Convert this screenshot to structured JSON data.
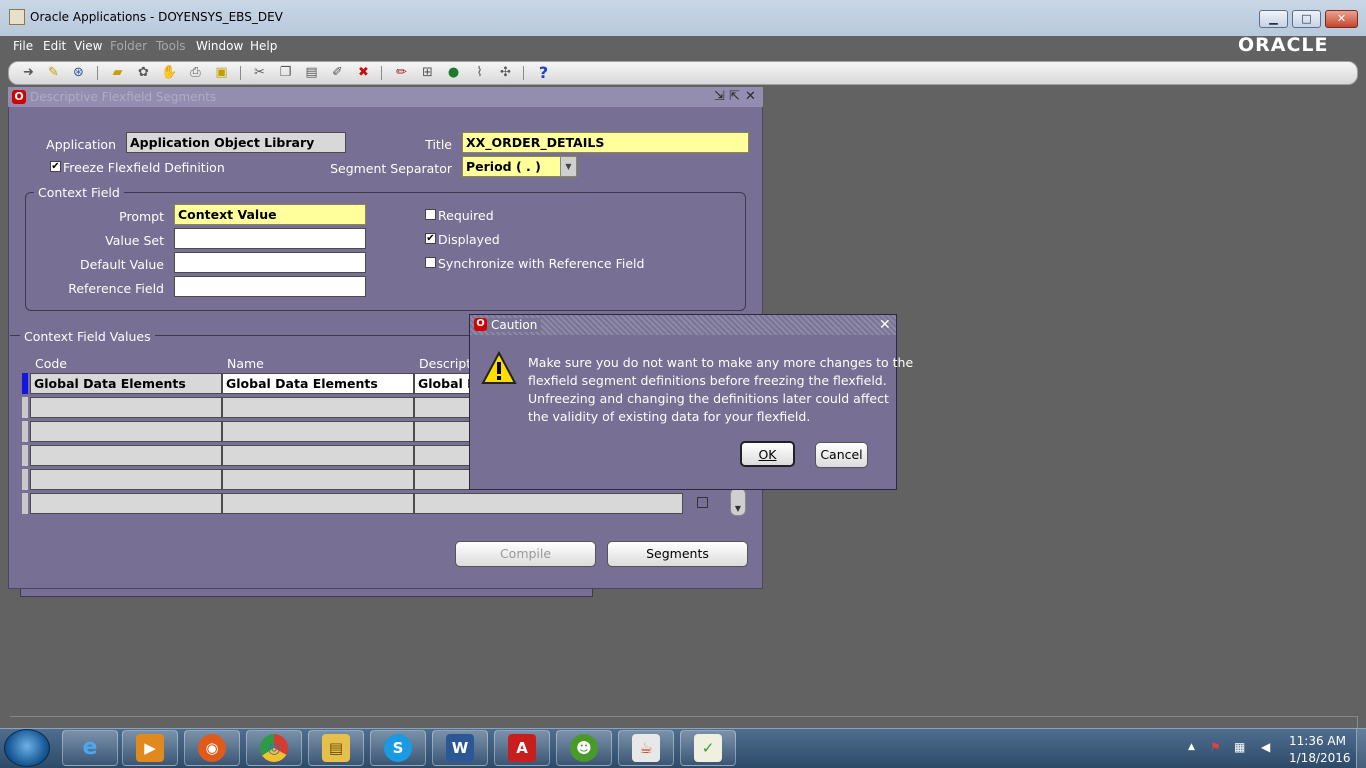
{
  "window": {
    "title": "Oracle Applications - DOYENSYS_EBS_DEV",
    "buttons": {
      "minimize": "▁",
      "maximize": "□",
      "close": "✕"
    }
  },
  "menu": [
    {
      "label": "File",
      "enabled": true
    },
    {
      "label": "Edit",
      "enabled": true
    },
    {
      "label": "View",
      "enabled": true
    },
    {
      "label": "Folder",
      "enabled": false
    },
    {
      "label": "Tools",
      "enabled": false
    },
    {
      "label": "Window",
      "enabled": true
    },
    {
      "label": "Help",
      "enabled": true
    }
  ],
  "brand": {
    "logo_text": "ORACLE"
  },
  "toolbar": {
    "icons": [
      "new-icon",
      "find-icon",
      "navigator-icon",
      "save-icon",
      "next-step-icon",
      "switch-responsibility-icon",
      "print-icon",
      "close-form-icon",
      "cut-icon",
      "copy-icon",
      "paste-icon",
      "new-record-icon",
      "delete-record-icon",
      "edit-field-icon",
      "zoom-icon",
      "translations-icon",
      "attachments-icon",
      "folder-tools-icon",
      "help-icon"
    ]
  },
  "form": {
    "title": "Descriptive Flexfield Segments",
    "application_label": "Application",
    "application_value": "Application Object Library",
    "title_label": "Title",
    "title_value": "XX_ORDER_DETAILS",
    "freeze_label": "Freeze Flexfield Definition",
    "freeze_checked": true,
    "separator_label": "Segment Separator",
    "separator_value": "Period ( . )",
    "context_group_label": "Context Field",
    "prompt_label": "Prompt",
    "prompt_value": "Context Value",
    "valueset_label": "Value Set",
    "valueset_value": "",
    "default_label": "Default Value",
    "default_value": "",
    "reference_label": "Reference Field",
    "reference_value": "",
    "required_label": "Required",
    "required_checked": false,
    "displayed_label": "Displayed",
    "displayed_checked": true,
    "sync_label": "Synchronize with Reference Field",
    "sync_checked": false,
    "values_group_label": "Context Field Values",
    "columns": {
      "code": "Code",
      "name": "Name",
      "description": "Descripti"
    },
    "rows": [
      {
        "code": "Global Data Elements",
        "name": "Global Data Elements",
        "description": "Global D"
      },
      {
        "code": "",
        "name": "",
        "description": ""
      },
      {
        "code": "",
        "name": "",
        "description": ""
      },
      {
        "code": "",
        "name": "",
        "description": ""
      },
      {
        "code": "",
        "name": "",
        "description": ""
      },
      {
        "code": "",
        "name": "",
        "description": ""
      }
    ],
    "compile_label": "Compile",
    "segments_label": "Segments"
  },
  "dialog": {
    "title": "Caution",
    "message_lines": [
      "Make sure you do not want to make any more changes to the",
      "flexfield segment definitions before freezing the flexfield.",
      "Unfreezing and changing the definitions later could affect",
      "the validity of existing data for your flexfield."
    ],
    "ok_label": "OK",
    "cancel_label": "Cancel"
  },
  "taskbar": {
    "apps": [
      {
        "name": "internet-explorer",
        "glyph": "e",
        "color": "#1e7fd6"
      },
      {
        "name": "media-player",
        "glyph": "▶",
        "color": "#e08a1e"
      },
      {
        "name": "firefox",
        "glyph": "◉",
        "color": "#e05a1a"
      },
      {
        "name": "chrome",
        "glyph": "◎",
        "color": "#d63b2e"
      },
      {
        "name": "file-explorer",
        "glyph": "▤",
        "color": "#e6c04a"
      },
      {
        "name": "skype",
        "glyph": "S",
        "color": "#1a9ae0"
      },
      {
        "name": "word",
        "glyph": "W",
        "color": "#2b5797"
      },
      {
        "name": "acrobat",
        "glyph": "A",
        "color": "#c81e1e"
      },
      {
        "name": "toad",
        "glyph": "☻",
        "color": "#4a9a2a"
      },
      {
        "name": "java",
        "glyph": "☕",
        "color": "#d8d8d8"
      },
      {
        "name": "task-manager",
        "glyph": "✓",
        "color": "#3a9a3a"
      }
    ],
    "clock_time": "11:36 AM",
    "clock_date": "1/18/2016"
  }
}
